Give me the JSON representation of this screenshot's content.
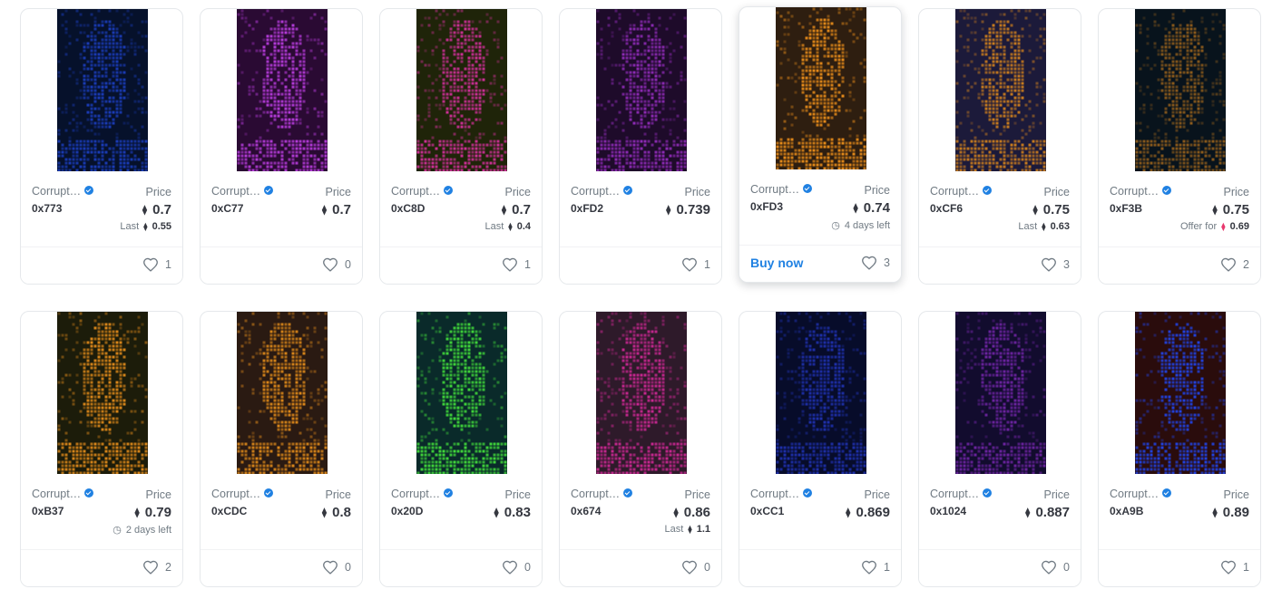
{
  "cards": [
    {
      "collection": "Corrupt…",
      "token": "0xB37",
      "price": "0.79",
      "price_label": "Price",
      "sub": {
        "type": "time",
        "text": "2 days left"
      },
      "likes": "2",
      "bg": "#1c1c0a",
      "fg": "#d9861a"
    }
  ],
  "grid": [
    {
      "collection": "Corrupt…",
      "token": "0x773",
      "price_label": "Price",
      "price": "0.7",
      "sub": {
        "type": "last",
        "label": "Last",
        "value": "0.55"
      },
      "likes": "1",
      "buy": "",
      "bg": "#06112b",
      "fg": "#1a3bb5"
    },
    {
      "collection": "Corrupt…",
      "token": "0xC77",
      "price_label": "Price",
      "price": "0.7",
      "sub": null,
      "likes": "0",
      "buy": "",
      "bg": "#2a0a33",
      "fg": "#b23ad6"
    },
    {
      "collection": "Corrupt…",
      "token": "0xC8D",
      "price_label": "Price",
      "price": "0.7",
      "sub": {
        "type": "last",
        "label": "Last",
        "value": "0.4"
      },
      "likes": "1",
      "buy": "",
      "bg": "#1f2409",
      "fg": "#cc2f96"
    },
    {
      "collection": "Corrupt…",
      "token": "0xFD2",
      "price_label": "Price",
      "price": "0.739",
      "sub": null,
      "likes": "1",
      "buy": "",
      "bg": "#1e0b2a",
      "fg": "#8c2ab3"
    },
    {
      "collection": "Corrupt…",
      "token": "0xFD3",
      "price_label": "Price",
      "price": "0.74",
      "sub": {
        "type": "time",
        "text": "4 days left"
      },
      "likes": "3",
      "buy": "Buy now",
      "bg": "#2e1e10",
      "fg": "#e48a1a"
    },
    {
      "collection": "Corrupt…",
      "token": "0xCF6",
      "price_label": "Price",
      "price": "0.75",
      "sub": {
        "type": "last",
        "label": "Last",
        "value": "0.63"
      },
      "likes": "3",
      "buy": "",
      "bg": "#1c1a3a",
      "fg": "#c57a1f"
    },
    {
      "collection": "Corrupt…",
      "token": "0xF3B",
      "price_label": "Price",
      "price": "0.75",
      "sub": {
        "type": "offer",
        "label": "Offer for",
        "value": "0.69"
      },
      "likes": "2",
      "buy": "",
      "bg": "#08131c",
      "fg": "#8a5a1c"
    },
    {
      "collection": "Corrupt…",
      "token": "0xB37",
      "price_label": "Price",
      "price": "0.79",
      "sub": {
        "type": "time",
        "text": "2 days left"
      },
      "likes": "2",
      "buy": "",
      "bg": "#1c1c0a",
      "fg": "#d9861a"
    },
    {
      "collection": "Corrupt…",
      "token": "0xCDC",
      "price_label": "Price",
      "price": "0.8",
      "sub": null,
      "likes": "0",
      "buy": "",
      "bg": "#2a1a12",
      "fg": "#d9861a"
    },
    {
      "collection": "Corrupt…",
      "token": "0x20D",
      "price_label": "Price",
      "price": "0.83",
      "sub": null,
      "likes": "0",
      "buy": "",
      "bg": "#0a2a2a",
      "fg": "#3fd43a"
    },
    {
      "collection": "Corrupt…",
      "token": "0x674",
      "price_label": "Price",
      "price": "0.86",
      "sub": {
        "type": "last",
        "label": "Last",
        "value": "1.1"
      },
      "likes": "0",
      "buy": "",
      "bg": "#2e1a2a",
      "fg": "#c6278f"
    },
    {
      "collection": "Corrupt…",
      "token": "0xCC1",
      "price_label": "Price",
      "price": "0.869",
      "sub": null,
      "likes": "1",
      "buy": "",
      "bg": "#070c2a",
      "fg": "#1e2fa8"
    },
    {
      "collection": "Corrupt…",
      "token": "0x1024",
      "price_label": "Price",
      "price": "0.887",
      "sub": null,
      "likes": "0",
      "buy": "",
      "bg": "#120c2e",
      "fg": "#6a239e"
    },
    {
      "collection": "Corrupt…",
      "token": "0xA9B",
      "price_label": "Price",
      "price": "0.89",
      "sub": null,
      "likes": "1",
      "buy": "",
      "bg": "#2a0c0c",
      "fg": "#2142e0"
    }
  ],
  "icons": {
    "verified": "verified-badge-icon",
    "eth": "ethereum-icon",
    "heart": "heart-icon",
    "clock": "clock-icon"
  },
  "eth_glyph": "⧫",
  "clock_glyph": "◷"
}
